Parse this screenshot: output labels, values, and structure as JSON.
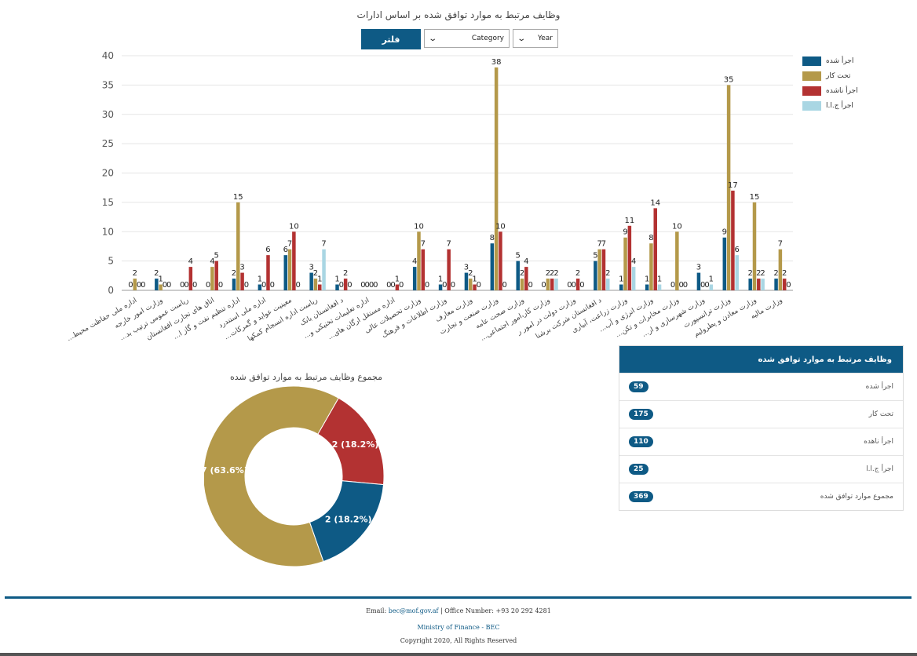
{
  "page": {
    "title": "وظایف مرتبط به موارد توافق شده بر اساس ادارات",
    "filter_button": "فلتر",
    "category_select": "Category",
    "year_select": "Year"
  },
  "colors": {
    "blue": "#0e5a85",
    "gold": "#b4994a",
    "red": "#b33232",
    "light": "#a9d6e3"
  },
  "chart_data": [
    {
      "type": "bar",
      "title": "وظایف مرتبط به موارد توافق شده بر اساس ادارات",
      "ylim": [
        0,
        40
      ],
      "yticks": [
        0,
        5,
        10,
        15,
        20,
        25,
        30,
        35,
        40
      ],
      "grid": true,
      "legend_position": "right",
      "categories": [
        "...اداره ملی حفاظت محیط",
        "وزارت امور خارجه",
        "...ریاست عمومی ترتیب بد",
        "اتاق های تجارت افغانستان",
        "...اداره تنظیم نفت و گاز ا",
        "اداره ملی استندرد",
        "...معینیت عواید و گمرکات",
        "ریاست اداره انسجام کمکها",
        "د افغانستان بانک",
        "...اداره تعلیمات تخنیکی و",
        "...اداره مستقل ارگان های",
        "وزارت تحصیلات عالی",
        "وزارت اطلاعات و فرهنگ",
        "وزارت معارف",
        "وزارت صنعت و تجارت",
        "وزارت صحت عامه",
        "...وزارت کار،امور اجتماعی",
        "وزارت دولت در امور ر",
        "د افغانستان شرکت برشنا",
        "وزارت زراعت، آبیاری",
        "...وزارت انرژی و آب",
        "...وزارت مخابرات و تکن",
        "...وزارت شهرسازی و ار",
        "وزارت ترانسپورت",
        "وزارت معادن و پطرولیم",
        "وزارت مالیه"
      ],
      "series": [
        {
          "name": "اجرأ شده",
          "values": [
            0,
            2,
            0,
            0,
            2,
            1,
            6,
            3,
            1,
            0,
            0,
            4,
            1,
            3,
            8,
            5,
            0,
            0,
            5,
            1,
            1,
            0,
            3,
            9,
            2,
            2
          ]
        },
        {
          "name": "تحت کار",
          "values": [
            2,
            1,
            0,
            4,
            15,
            0,
            7,
            2,
            0,
            0,
            0,
            10,
            0,
            2,
            38,
            2,
            2,
            0,
            7,
            9,
            8,
            10,
            0,
            35,
            15,
            7
          ]
        },
        {
          "name": "اجرأ ناشده",
          "values": [
            0,
            0,
            4,
            5,
            3,
            6,
            10,
            1,
            2,
            0,
            1,
            7,
            7,
            1,
            10,
            4,
            2,
            2,
            7,
            11,
            14,
            0,
            0,
            17,
            2,
            2
          ]
        },
        {
          "name": "اجرأ ج.ا.ا",
          "values": [
            0,
            0,
            0,
            0,
            0,
            0,
            0,
            7,
            0,
            0,
            0,
            0,
            0,
            0,
            0,
            0,
            2,
            0,
            2,
            4,
            1,
            0,
            1,
            6,
            2,
            0
          ]
        }
      ]
    },
    {
      "type": "pie",
      "title": "مجموع وظایف مرتبط به موارد توافق شده",
      "slices": [
        {
          "label": "7 (63.6%)",
          "value": 7
        },
        {
          "label": "2 (18.2%)",
          "value": 2
        },
        {
          "label": "2 (18.2%)",
          "value": 2
        }
      ]
    }
  ],
  "summary_table": {
    "header": "وظایف مرتبط به موارد توافق شده",
    "rows": [
      {
        "label": "اجرأ شده",
        "value": "59"
      },
      {
        "label": "تحت کار",
        "value": "175"
      },
      {
        "label": "اجرأ ناهده",
        "value": "110"
      },
      {
        "label": "اجرأ ج.ا.ا",
        "value": "25"
      },
      {
        "label": "مجموع موارد توافق شده",
        "value": "369"
      }
    ]
  },
  "footer": {
    "email_label": "Email:",
    "email": "bec@mof.gov.af",
    "separator": "|",
    "office_label": "Office Number: +93 20 292 4281",
    "ministry": "Ministry of Finance - BEC",
    "copyright": "Copyright 2020, All Rights Reserved"
  }
}
